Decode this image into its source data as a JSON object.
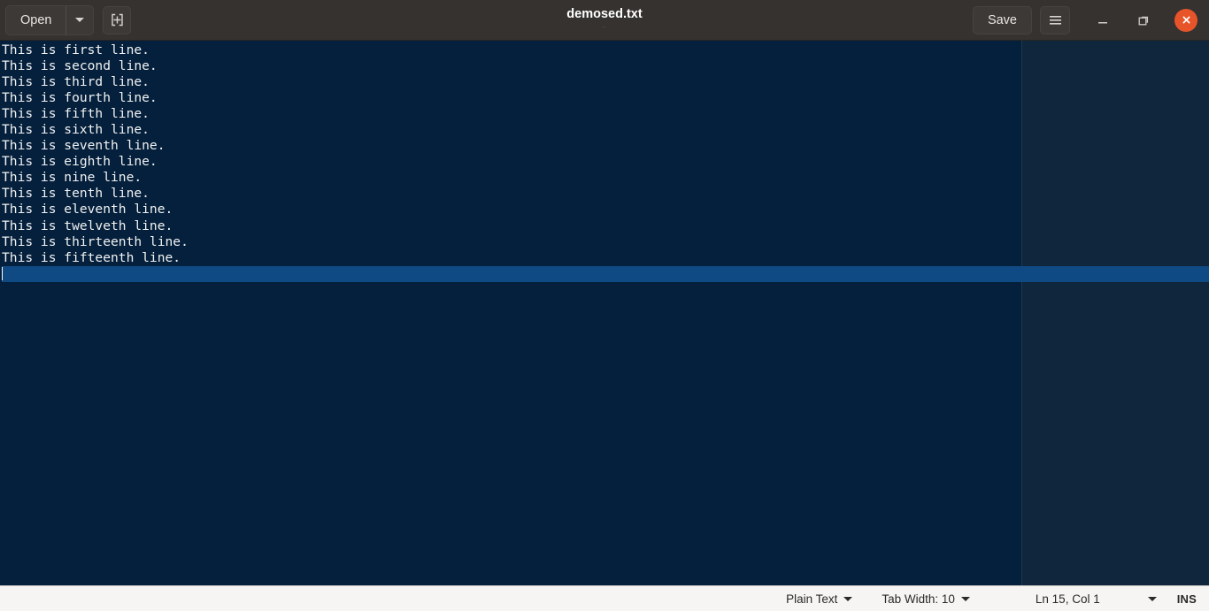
{
  "window": {
    "title": "demosed.txt",
    "subtitle": "~"
  },
  "headerbar": {
    "open_button": {
      "label": "Open",
      "dropdown_icon": "chevron-down-icon"
    },
    "new_document_button": {
      "icon": "new-document-icon",
      "label": ""
    },
    "save_button": {
      "label": "Save"
    },
    "menu_button": {
      "icon": "hamburger-menu-icon"
    },
    "window_controls": {
      "minimize": "minimize-icon",
      "maximize": "restore-icon",
      "close": "close-icon",
      "close_color": "#e8542a"
    }
  },
  "editor": {
    "background_color": "#04203c",
    "overflow_background_color": "#10263c",
    "current_line_color": "#03407b",
    "text_color": "#f2f2f2",
    "right_margin_column_x": 1154,
    "lines": [
      "This is first line.",
      "This is second line.",
      "This is third line.",
      "This is fourth line.",
      "This is fifth line.",
      "This is sixth line.",
      "This is seventh line.",
      "This is eighth line.",
      "This is nine line.",
      "This is tenth line.",
      "This is eleventh line.",
      "This is twelveth line.",
      "This is thirteenth line.",
      "This is fifteenth line.",
      ""
    ],
    "current_line_index": 14
  },
  "statusbar": {
    "language": "Plain Text",
    "tab_width": "Tab Width: 10",
    "position": "Ln 15, Col 1",
    "insert_mode": "INS"
  }
}
